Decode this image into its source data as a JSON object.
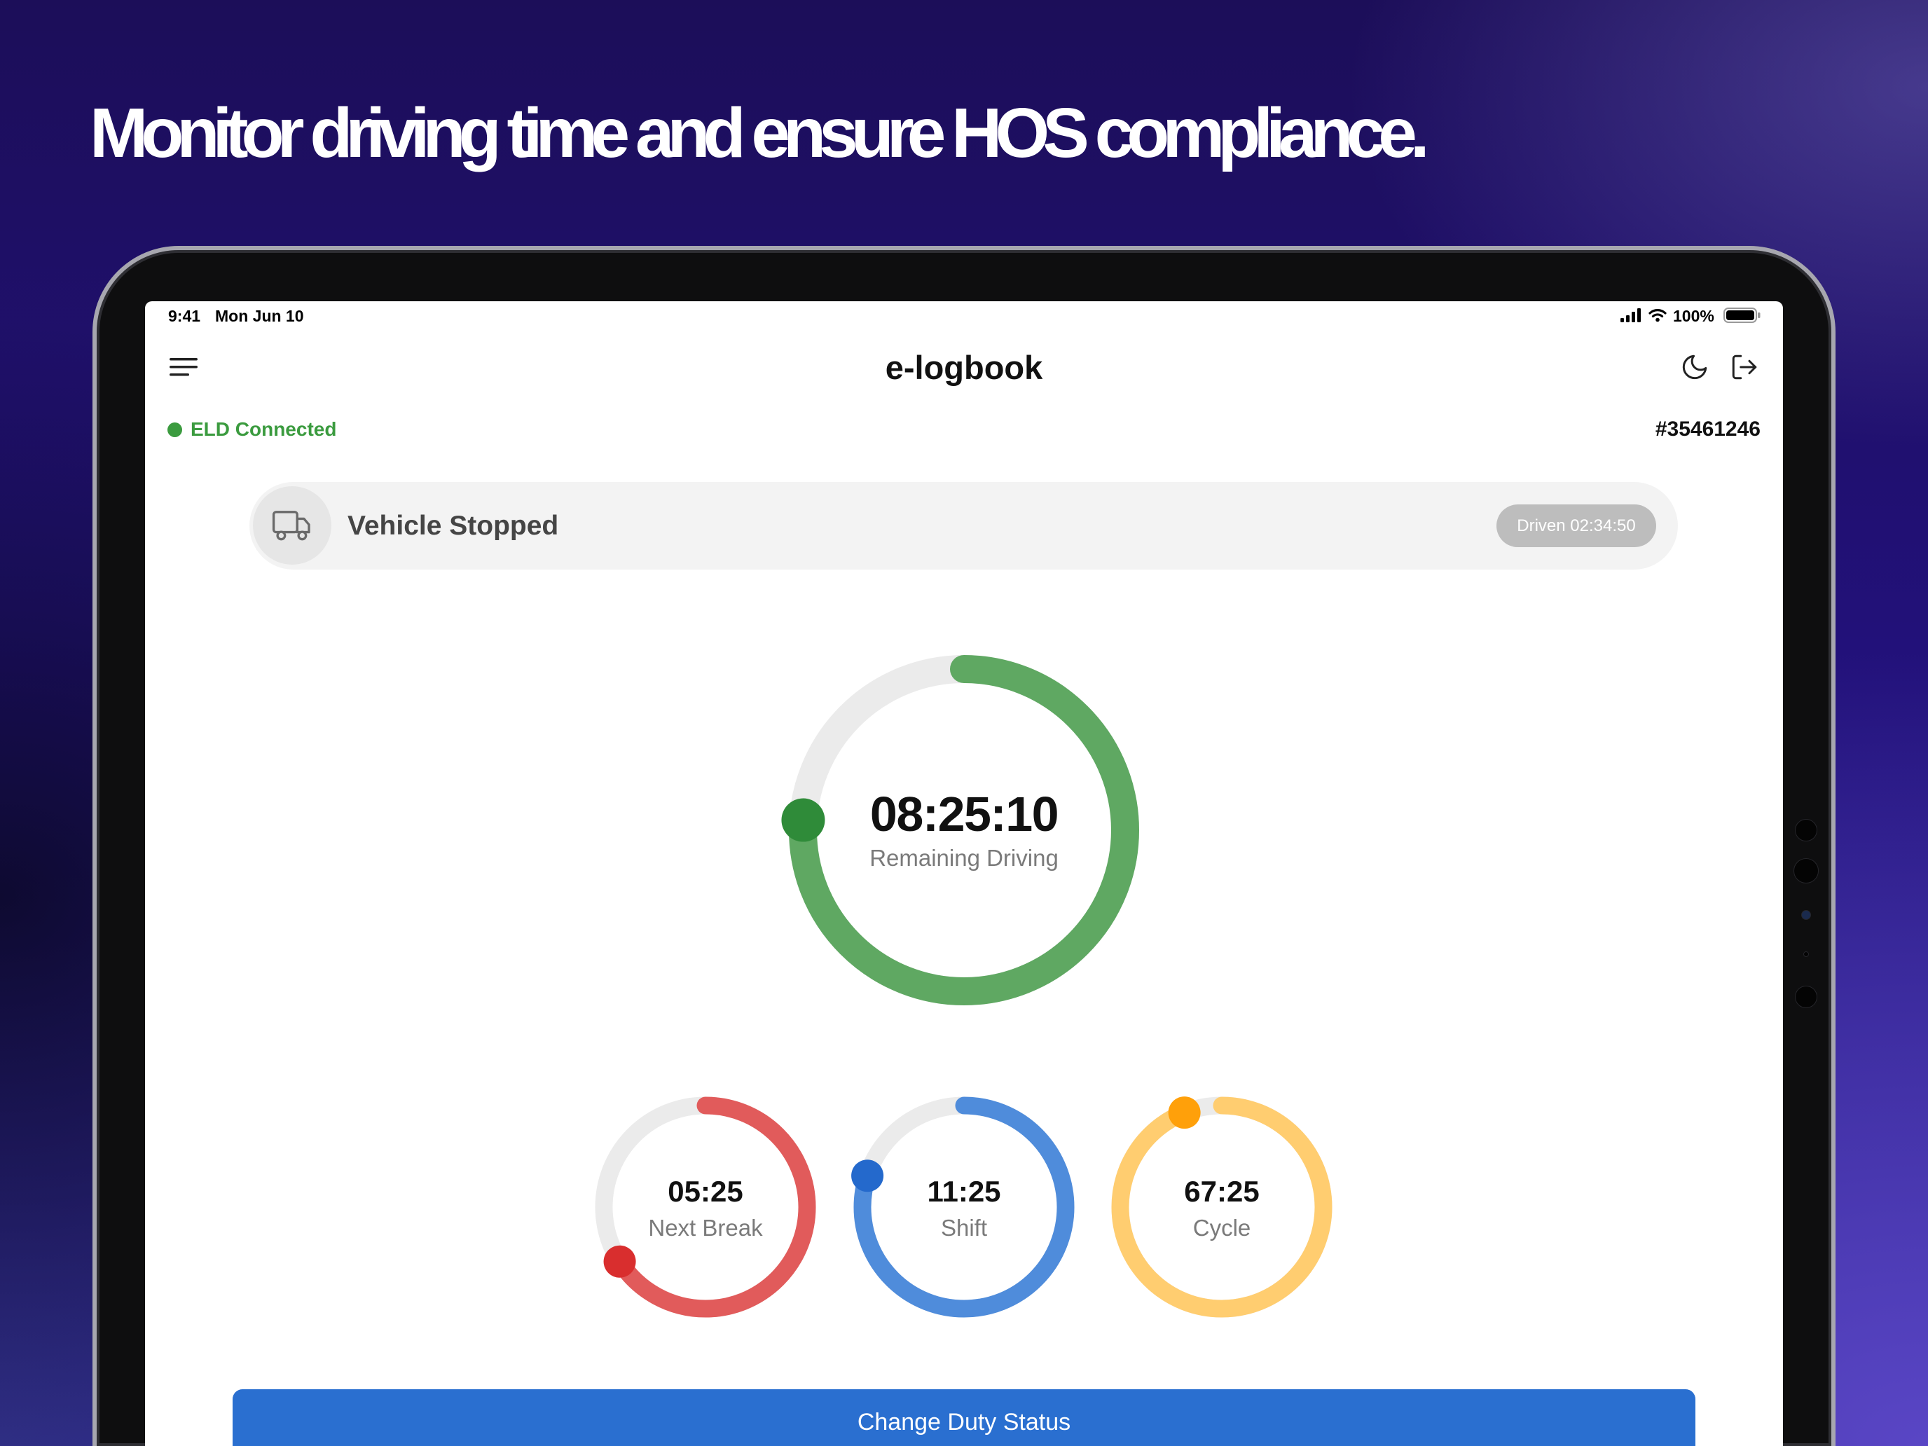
{
  "headline": "Monitor driving time and ensure HOS compliance.",
  "status_bar": {
    "time": "9:41",
    "date": "Mon Jun 10",
    "battery": "100%",
    "icons": [
      "signal-icon",
      "wifi-icon",
      "battery-icon"
    ]
  },
  "nav": {
    "title": "e-logbook",
    "icons": [
      "menu-icon",
      "moon-icon",
      "logout-icon"
    ]
  },
  "eld": {
    "status": "ELD Connected",
    "device_id": "#35461246"
  },
  "vehicle": {
    "status": "Vehicle Stopped",
    "driven": "Driven 02:34:50",
    "icon": "truck-icon"
  },
  "main_timer": {
    "value": "08:25:10",
    "label": "Remaining Driving",
    "progress": 0.76,
    "color": "#5fa862",
    "dot_color": "#2f8b39"
  },
  "timers": [
    {
      "value": "05:25",
      "label": "Next Break",
      "progress": 0.66,
      "color": "#e15b5b",
      "dot_color": "#d92e2e"
    },
    {
      "value": "11:25",
      "label": "Shift",
      "progress": 0.8,
      "color": "#4f8cdb",
      "dot_color": "#2469cc"
    },
    {
      "value": "67:25",
      "label": "Cycle",
      "progress": 0.94,
      "color": "#ffcd70",
      "dot_color": "#ffa00a"
    }
  ],
  "button": {
    "label": "Change Duty Status"
  },
  "colors": {
    "track": "#ebebeb",
    "eld_connected": "#3b9b3f",
    "button": "#2a6fd0"
  }
}
